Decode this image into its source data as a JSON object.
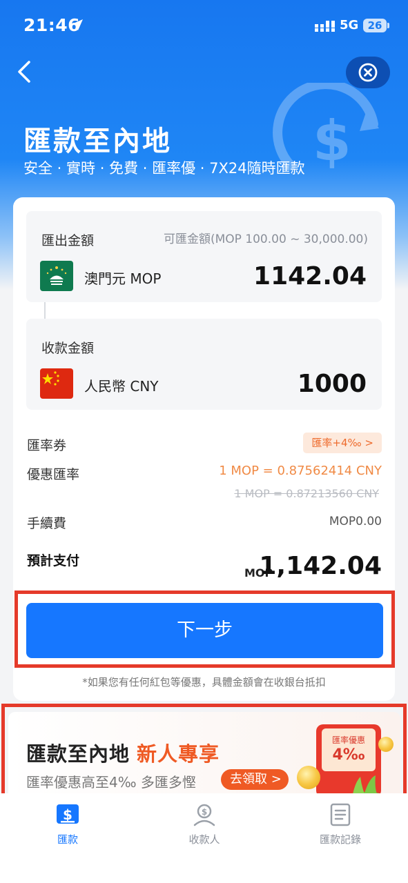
{
  "status_bar": {
    "time": "21:46",
    "network": "5G",
    "battery": "26"
  },
  "header": {
    "title": "匯款至內地",
    "subtitle": "安全 · 實時 · 免費 · 匯率優 · 7X24隨時匯款"
  },
  "send": {
    "label": "匯出金額",
    "range": "可匯金額(MOP 100.00 ~ 30,000.00)",
    "currency": "澳門元 MOP",
    "amount": "1142.04"
  },
  "receive": {
    "label": "收款金額",
    "currency": "人民幣 CNY",
    "amount": "1000"
  },
  "details": {
    "coupon_label": "匯率券",
    "coupon_tag": "匯率+4‰ >",
    "rate_label": "優惠匯率",
    "rate_promo": "1 MOP = 0.87562414 CNY",
    "rate_original": "1 MOP = 0.87213560 CNY",
    "fee_label": "手續費",
    "fee_value": "MOP0.00",
    "total_label": "預計支付",
    "total_currency": "MOP",
    "total_value": "1,142.04"
  },
  "actions": {
    "next": "下一步",
    "note": "*如果您有任何紅包等優惠，具體金額會在收銀台抵扣"
  },
  "banner": {
    "title": "匯款至內地",
    "title_accent": "新人專享",
    "subtitle": "匯率優惠高至4‰ 多匯多慳",
    "cta": "去領取 >",
    "envelope_label": "匯率優惠",
    "envelope_value": "4‰"
  },
  "tabbar": {
    "items": [
      {
        "label": "匯款",
        "icon": "remit-icon",
        "active": true
      },
      {
        "label": "收款人",
        "icon": "payee-icon",
        "active": false
      },
      {
        "label": "匯款記錄",
        "icon": "records-icon",
        "active": false
      }
    ]
  },
  "colors": {
    "primary": "#1677ff",
    "accent": "#ef5a24",
    "highlight_outline": "#e53a2a"
  }
}
